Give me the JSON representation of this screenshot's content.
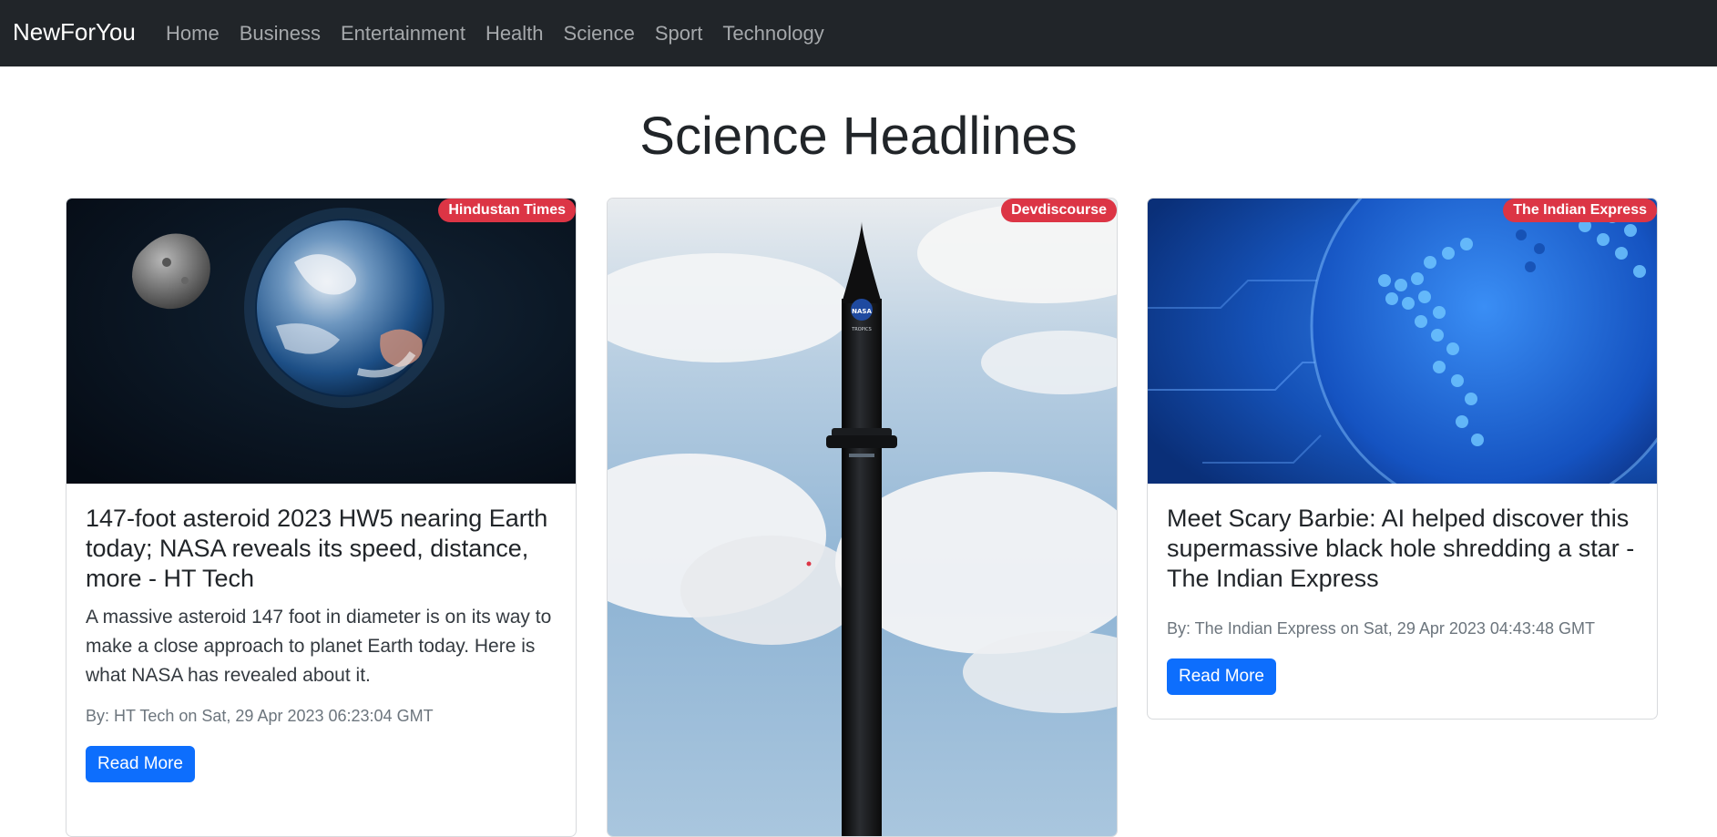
{
  "navbar": {
    "brand": "NewForYou",
    "links": [
      "Home",
      "Business",
      "Entertainment",
      "Health",
      "Science",
      "Sport",
      "Technology"
    ]
  },
  "page": {
    "heading": "Science Headlines"
  },
  "articles": [
    {
      "source": "Hindustan Times",
      "title": "147-foot asteroid 2023 HW5 nearing Earth today; NASA reveals its speed, distance, more - HT Tech",
      "description": "A massive asteroid 147 foot in diameter is on its way to make a close approach to planet Earth today. Here is what NASA has revealed about it.",
      "meta": "By: HT Tech on Sat, 29 Apr 2023 06:23:04 GMT",
      "button": "Read More",
      "image": "asteroid-earth-image"
    },
    {
      "source": "Devdiscourse",
      "image": "rocket-launch-image",
      "rocket_text": [
        "NASA",
        "TROPICS"
      ]
    },
    {
      "source": "The Indian Express",
      "title": "Meet Scary Barbie: AI helped discover this supermassive black hole shredding a star - The Indian Express",
      "meta": "By: The Indian Express on Sat, 29 Apr 2023 04:43:48 GMT",
      "button": "Read More",
      "image": "blue-globe-image"
    }
  ],
  "colors": {
    "navbar": "#212529",
    "badge": "#dc3545",
    "button": "#0d6efd"
  }
}
